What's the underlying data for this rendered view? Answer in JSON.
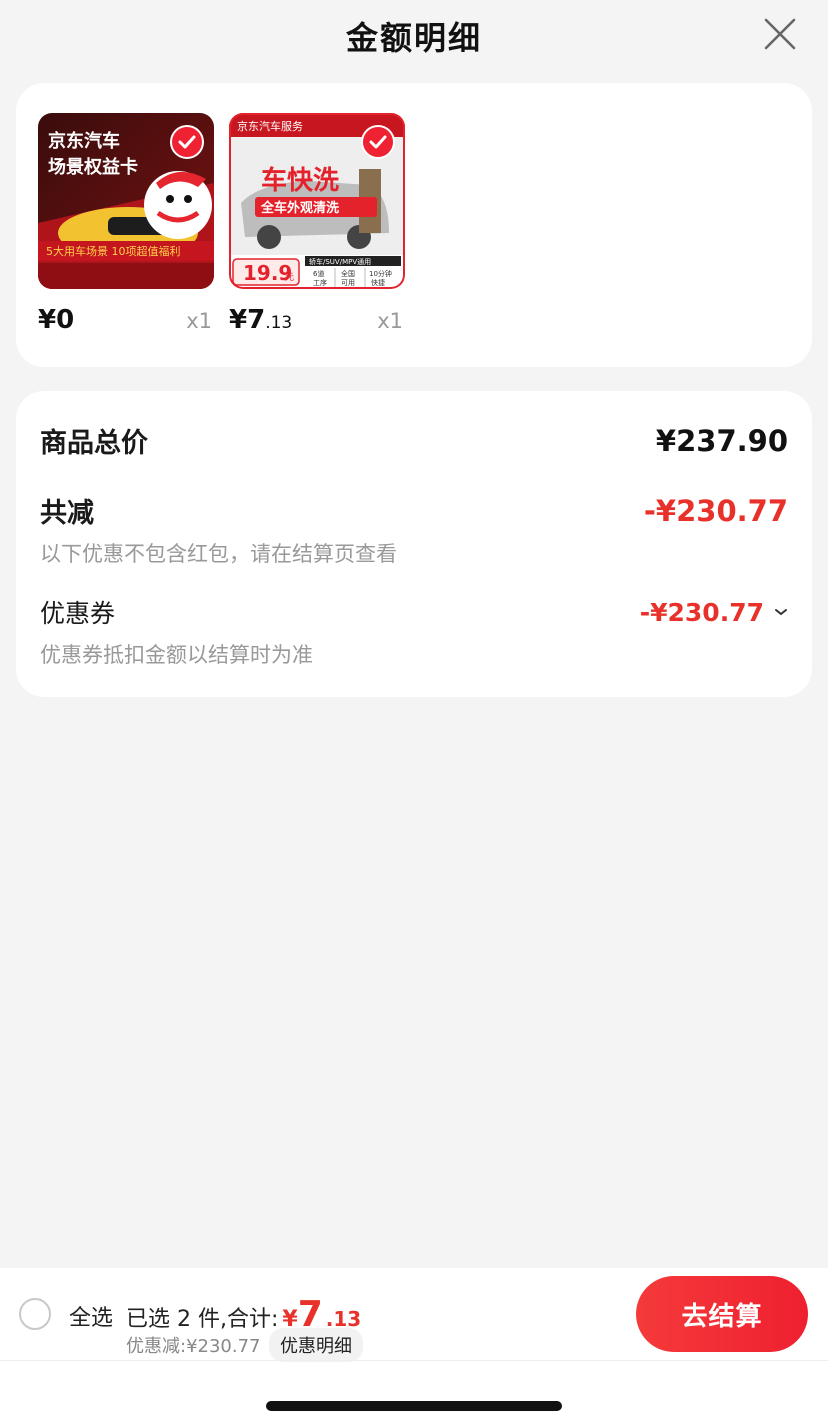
{
  "header": {
    "title": "金额明细"
  },
  "goods": [
    {
      "price_int": "¥0",
      "price_dec": "",
      "qty": "x1",
      "image_lines": [
        "京东汽车",
        "场景权益卡",
        "5大用车场景 10项超值福利"
      ]
    },
    {
      "price_int": "¥7",
      "price_dec": ".13",
      "qty": "x1",
      "image_lines": [
        "京东汽车服务",
        "车快洗",
        "全车外观清洗",
        "19.9",
        "元",
        "轿车/SUV/MPV通用",
        "6道",
        "工序",
        "全国",
        "可用",
        "10分钟",
        "快捷"
      ]
    }
  ],
  "summary": {
    "total_label": "商品总价",
    "total_value": "¥237.90",
    "reduce_label": "共减",
    "reduce_value": "-¥230.77",
    "reduce_note": "以下优惠不包含红包，请在结算页查看",
    "coupon_label": "优惠券",
    "coupon_value": "-¥230.77",
    "coupon_note": "优惠券抵扣金额以结算时为准"
  },
  "bottom": {
    "select_all": "全选",
    "selected_text": "已选 2 件,合计:",
    "total_yen": "¥",
    "total_int": "7",
    "total_dec": ".13",
    "discount": "优惠减:¥230.77",
    "detail_link": "优惠明细",
    "checkout": "去结算"
  },
  "colors": {
    "accent": "#e8312b",
    "button": "#ee2030",
    "background": "#f4f4f4"
  }
}
